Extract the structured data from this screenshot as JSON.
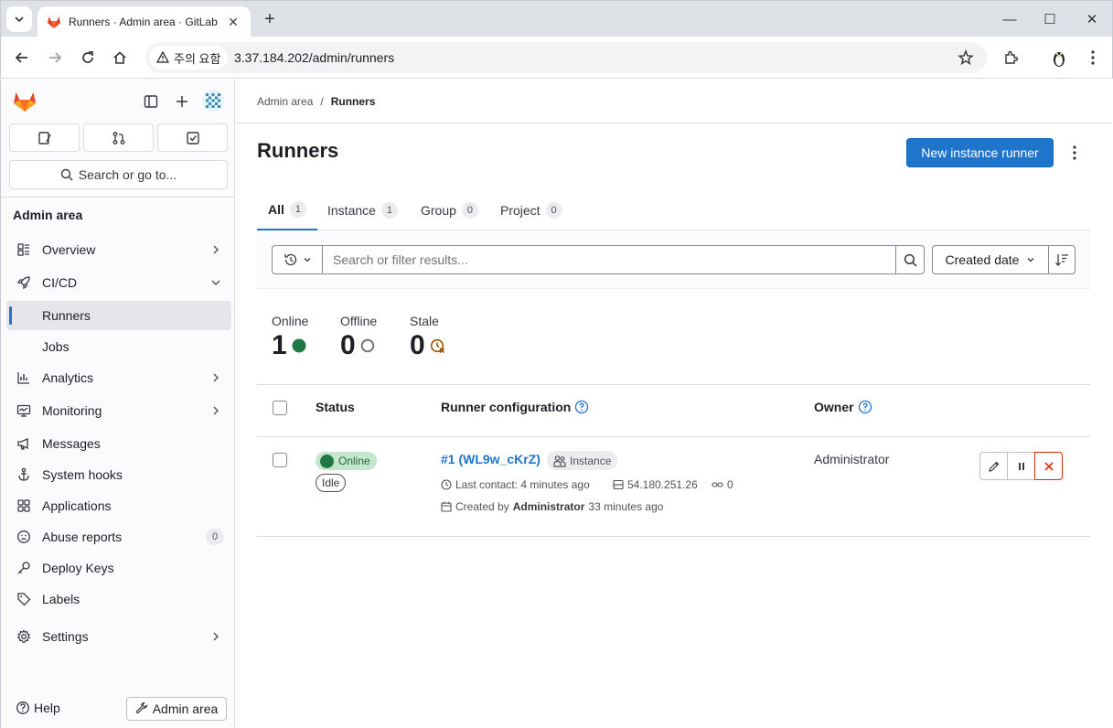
{
  "browser": {
    "tab_title": "Runners · Admin area · GitLab",
    "security_chip": "주의 요함",
    "url": "3.37.184.202/admin/runners"
  },
  "sidebar": {
    "search_label": "Search or go to...",
    "section_title": "Admin area",
    "items": [
      {
        "label": "Overview"
      },
      {
        "label": "CI/CD"
      },
      {
        "label": "Runners"
      },
      {
        "label": "Jobs"
      },
      {
        "label": "Analytics"
      },
      {
        "label": "Monitoring"
      },
      {
        "label": "Messages"
      },
      {
        "label": "System hooks"
      },
      {
        "label": "Applications"
      },
      {
        "label": "Abuse reports",
        "badge": "0"
      },
      {
        "label": "Deploy Keys"
      },
      {
        "label": "Labels"
      },
      {
        "label": "Settings"
      }
    ],
    "help_label": "Help",
    "admin_button_label": "Admin area"
  },
  "breadcrumb": {
    "parent": "Admin area",
    "separator": "/",
    "current": "Runners"
  },
  "page": {
    "title": "Runners",
    "new_runner_button": "New instance runner"
  },
  "tabs": [
    {
      "label": "All",
      "count": "1"
    },
    {
      "label": "Instance",
      "count": "1"
    },
    {
      "label": "Group",
      "count": "0"
    },
    {
      "label": "Project",
      "count": "0"
    }
  ],
  "filter": {
    "placeholder": "Search or filter results...",
    "sort_label": "Created date"
  },
  "stats": [
    {
      "label": "Online",
      "value": "1",
      "color": "#217645"
    },
    {
      "label": "Offline",
      "value": "0",
      "color": "#737278"
    },
    {
      "label": "Stale",
      "value": "0",
      "color": "#9e5400"
    }
  ],
  "table": {
    "headers": {
      "status": "Status",
      "config": "Runner configuration",
      "owner": "Owner"
    },
    "rows": [
      {
        "status": "Online",
        "idle": "Idle",
        "runner": "#1 (WL9w_cKrZ)",
        "type": "Instance",
        "last_contact": "Last contact: 4 minutes ago",
        "ip": "54.180.251.26",
        "jobs": "0",
        "created_prefix": "Created by",
        "created_by": "Administrator",
        "created_ago": "33 minutes ago",
        "owner": "Administrator"
      }
    ]
  },
  "colors": {
    "accent": "#1f75cb",
    "online": "#217645",
    "danger": "#dd2b0e",
    "gitlab_orange": "#e24329"
  }
}
